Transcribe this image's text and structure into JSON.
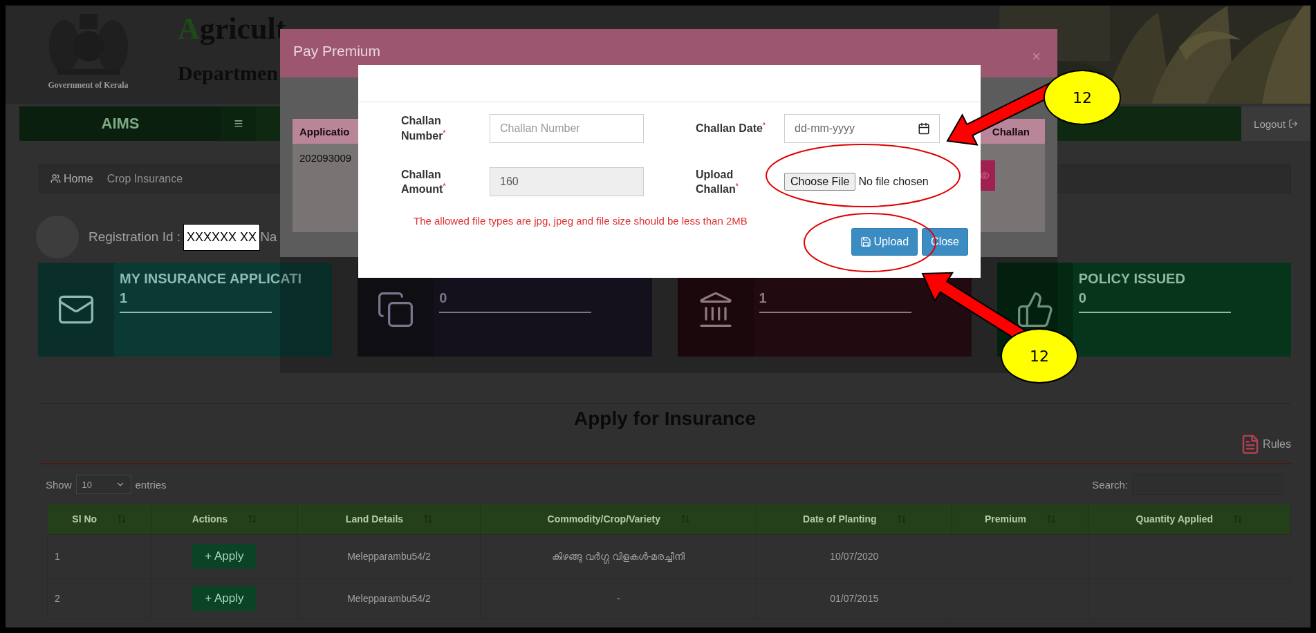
{
  "header": {
    "org": "Government of Kerala",
    "title": "Agricult",
    "subtitle": "Departmen"
  },
  "nav": {
    "brand": "AIMS",
    "menu_glyph": "≡",
    "logout": "Logout"
  },
  "breadcrumb": [
    {
      "label": "Home"
    },
    {
      "label": "Crop Insurance"
    }
  ],
  "registration": {
    "label": "Registration Id :",
    "value": "XXXXXX XX",
    "next_label": "Na"
  },
  "cards": [
    {
      "kind": "mail",
      "label": "MY INSURANCE APPLICATI",
      "value": "1"
    },
    {
      "kind": "copy",
      "value": "0"
    },
    {
      "kind": "bank",
      "value": "1"
    },
    {
      "kind": "like",
      "label": "POLICY ISSUED",
      "value": "0"
    }
  ],
  "section": {
    "title": "Apply for Insurance",
    "rules": "Rules"
  },
  "table_controls": {
    "show": "Show",
    "page_size": "10",
    "entries": "entries",
    "search_label": "Search:"
  },
  "table": {
    "columns": [
      "Sl No",
      "Actions",
      "Land Details",
      "Commodity/Crop/Variety",
      "Date of Planting",
      "Premium",
      "Quantity Applied"
    ],
    "rows": [
      {
        "sl_no": "1",
        "action": "+ Apply",
        "land": "Melepparambu54/2",
        "crop": "കിഴങ്ങു വർഗ്ഗ വിളകൾ-മരച്ചീനി",
        "date": "10/07/2020"
      },
      {
        "sl_no": "2",
        "action": "+ Apply",
        "land": "Melepparambu54/2",
        "crop": "-",
        "date": "01/07/2015"
      }
    ]
  },
  "back_modal": {
    "title": "Pay Premium",
    "close": "×",
    "columns": [
      "Applicatio",
      "Challan"
    ],
    "application": "202093009"
  },
  "dialog": {
    "fields": [
      {
        "kind": "text",
        "label": "Challan Number",
        "required_mark": "*",
        "placeholder": "Challan Number",
        "disabled": false
      },
      {
        "kind": "date",
        "label": "Challan Date",
        "required_mark": "*",
        "placeholder": "dd-mm-yyyy"
      },
      {
        "kind": "text",
        "label": "Challan Amount",
        "required_mark": "*",
        "value": "160",
        "disabled": true
      },
      {
        "kind": "file",
        "label": "Upload Challan",
        "required_mark": "*",
        "button": "Choose File",
        "status": "No file chosen"
      }
    ],
    "note": "The allowed file types are jpg, jpeg and file size should be less than 2MB",
    "buttons": [
      {
        "kind": "save",
        "label": "Upload"
      },
      {
        "kind": "plain",
        "label": "Close"
      }
    ]
  },
  "annotations": [
    {
      "label": "12"
    },
    {
      "label": "12"
    }
  ]
}
